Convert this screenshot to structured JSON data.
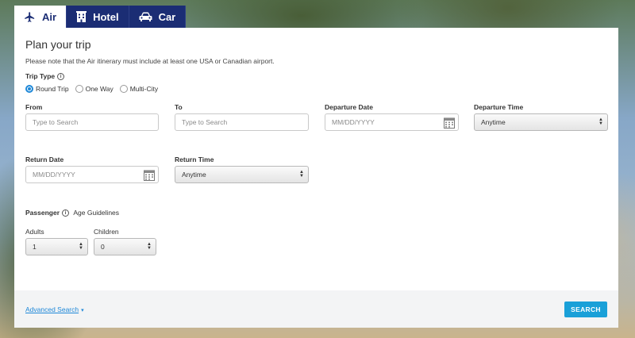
{
  "tabs": [
    {
      "label": "Air",
      "icon": "airplane-icon"
    },
    {
      "label": "Hotel",
      "icon": "hotel-building-icon"
    },
    {
      "label": "Car",
      "icon": "car-icon"
    }
  ],
  "form": {
    "title": "Plan your trip",
    "note": "Please note that the Air itinerary must include at least one USA or Canadian airport.",
    "trip_type": {
      "label": "Trip Type",
      "options": [
        "Round Trip",
        "One Way",
        "Multi-City"
      ],
      "selected": "Round Trip"
    },
    "from": {
      "label": "From",
      "placeholder": "Type to Search"
    },
    "to": {
      "label": "To",
      "placeholder": "Type to Search"
    },
    "departure_date": {
      "label": "Departure Date",
      "placeholder": "MM/DD/YYYY"
    },
    "departure_time": {
      "label": "Departure Time",
      "value": "Anytime"
    },
    "return_date": {
      "label": "Return Date",
      "placeholder": "MM/DD/YYYY"
    },
    "return_time": {
      "label": "Return Time",
      "value": "Anytime"
    },
    "passenger": {
      "label": "Passenger",
      "guidelines": "Age Guidelines"
    },
    "adults": {
      "label": "Adults",
      "value": "1"
    },
    "children": {
      "label": "Children",
      "value": "0"
    }
  },
  "footer": {
    "advanced_search": "Advanced Search",
    "search_button": "SEARCH"
  },
  "colors": {
    "tab_bg": "#1b2d74",
    "accent": "#1aa0d8",
    "link": "#1e88d8"
  }
}
